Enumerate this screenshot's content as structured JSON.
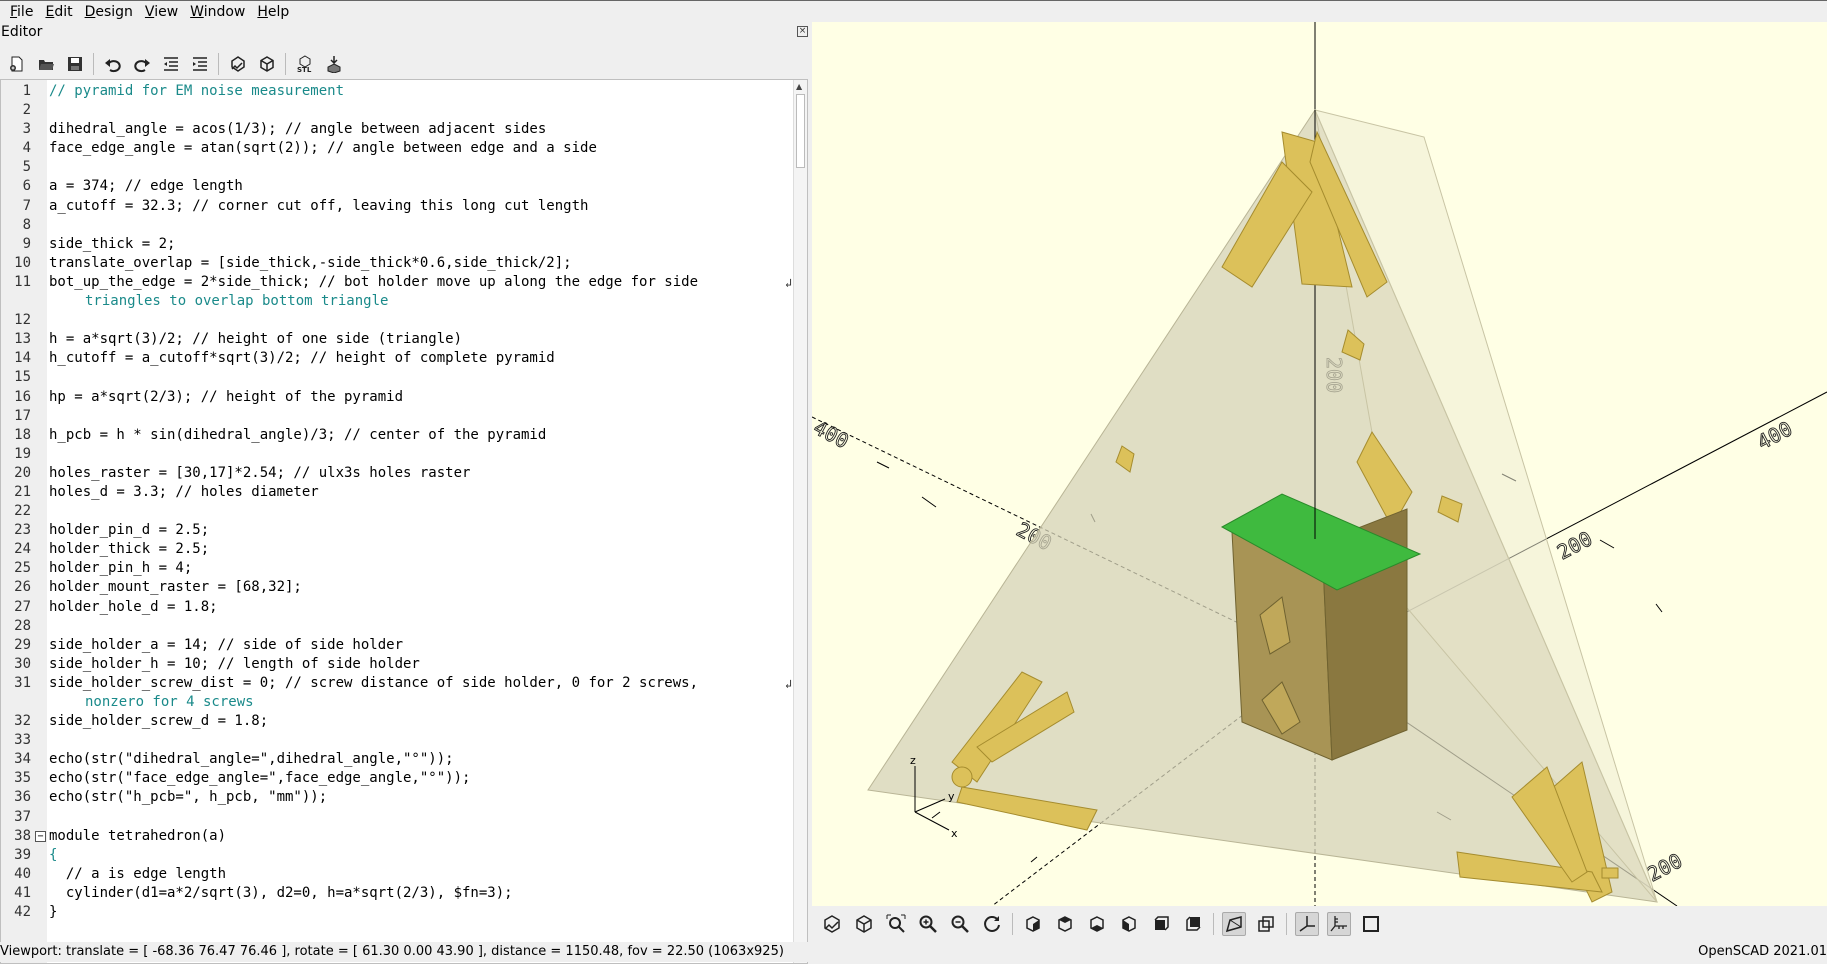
{
  "menu": [
    "File",
    "Edit",
    "Design",
    "View",
    "Window",
    "Help"
  ],
  "editor": {
    "title": "Editor",
    "toolbar": [
      "new-icon",
      "open-icon",
      "save-icon",
      "undo-icon",
      "redo-icon",
      "unindent-icon",
      "indent-icon",
      "preview-icon",
      "render-icon",
      "export-stl-icon",
      "send-to-print-icon"
    ],
    "code": [
      {
        "n": "1",
        "t": "// pyramid for EM noise measurement"
      },
      {
        "n": "2",
        "t": ""
      },
      {
        "n": "3",
        "t": "dihedral_angle = acos(1/3); // angle between adjacent sides"
      },
      {
        "n": "4",
        "t": "face_edge_angle = atan(sqrt(2)); // angle between edge and a side"
      },
      {
        "n": "5",
        "t": ""
      },
      {
        "n": "6",
        "t": "a = 374; // edge length"
      },
      {
        "n": "7",
        "t": "a_cutoff = 32.3; // corner cut off, leaving this long cut length"
      },
      {
        "n": "8",
        "t": ""
      },
      {
        "n": "9",
        "t": "side_thick = 2;"
      },
      {
        "n": "10",
        "t": "translate_overlap = [side_thick,-side_thick*0.6,side_thick/2];"
      },
      {
        "n": "11",
        "t": "bot_up_the_edge = 2*side_thick; // bot holder move up along the edge for side"
      },
      {
        "n": "",
        "t": "triangles to overlap bottom triangle",
        "wrap": true
      },
      {
        "n": "12",
        "t": ""
      },
      {
        "n": "13",
        "t": "h = a*sqrt(3)/2; // height of one side (triangle)"
      },
      {
        "n": "14",
        "t": "h_cutoff = a_cutoff*sqrt(3)/2; // height of complete pyramid"
      },
      {
        "n": "15",
        "t": ""
      },
      {
        "n": "16",
        "t": "hp = a*sqrt(2/3); // height of the pyramid"
      },
      {
        "n": "17",
        "t": ""
      },
      {
        "n": "18",
        "t": "h_pcb = h * sin(dihedral_angle)/3; // center of the pyramid"
      },
      {
        "n": "19",
        "t": ""
      },
      {
        "n": "20",
        "t": "holes_raster = [30,17]*2.54; // ulx3s holes raster"
      },
      {
        "n": "21",
        "t": "holes_d = 3.3; // holes diameter"
      },
      {
        "n": "22",
        "t": ""
      },
      {
        "n": "23",
        "t": "holder_pin_d = 2.5;"
      },
      {
        "n": "24",
        "t": "holder_thick = 2.5;"
      },
      {
        "n": "25",
        "t": "holder_pin_h = 4;"
      },
      {
        "n": "26",
        "t": "holder_mount_raster = [68,32];"
      },
      {
        "n": "27",
        "t": "holder_hole_d = 1.8;"
      },
      {
        "n": "28",
        "t": ""
      },
      {
        "n": "29",
        "t": "side_holder_a = 14; // side of side holder"
      },
      {
        "n": "30",
        "t": "side_holder_h = 10; // length of side holder"
      },
      {
        "n": "31",
        "t": "side_holder_screw_dist = 0; // screw distance of side holder, 0 for 2 screws,"
      },
      {
        "n": "",
        "t": "nonzero for 4 screws",
        "wrap": true
      },
      {
        "n": "32",
        "t": "side_holder_screw_d = 1.8;"
      },
      {
        "n": "33",
        "t": ""
      },
      {
        "n": "34",
        "t": "echo(str(\"dihedral_angle=\",dihedral_angle,\"°\"));"
      },
      {
        "n": "35",
        "t": "echo(str(\"face_edge_angle=\",face_edge_angle,\"°\"));"
      },
      {
        "n": "36",
        "t": "echo(str(\"h_pcb=\", h_pcb, \"mm\"));"
      },
      {
        "n": "37",
        "t": ""
      },
      {
        "n": "38",
        "t": "module tetrahedron(a)"
      },
      {
        "n": "39",
        "t": "{"
      },
      {
        "n": "40",
        "t": "  // a is edge length"
      },
      {
        "n": "41",
        "t": "  cylinder(d1=a*2/sqrt(3), d2=0, h=a*sqrt(2/3), $fn=3);"
      },
      {
        "n": "42",
        "t": "}"
      },
      {
        "n": "43",
        "t": ""
      }
    ]
  },
  "viewport": {
    "axis_labels": [
      "200",
      "200",
      "200",
      "200",
      "200",
      "200",
      "400",
      "400"
    ],
    "axes_gizmo": {
      "x": "x",
      "y": "y",
      "z": "z"
    },
    "colors": {
      "background": "#ffffe5",
      "pyramid": "#d6d3b8",
      "parts": "#dcc15a",
      "pcb": "#3fba3f",
      "box": "#8a7840"
    }
  },
  "view_toolbar": [
    "preview-icon",
    "render-icon",
    "view-all-icon",
    "zoom-in-icon",
    "zoom-out-icon",
    "reset-view-icon",
    "view-right-icon",
    "view-top-icon",
    "view-bottom-icon",
    "view-left-icon",
    "view-front-icon",
    "view-back-icon",
    "perspective-icon",
    "orthogonal-icon",
    "show-axes-icon",
    "show-scale-markers-icon",
    "show-edges-icon"
  ],
  "status": {
    "viewport": "Viewport: translate = [ -68.36 76.47 76.46 ], rotate = [ 61.30 0.00 43.90 ], distance = 1150.48, fov = 22.50 (1063x925)",
    "version": "OpenSCAD 2021.01"
  }
}
